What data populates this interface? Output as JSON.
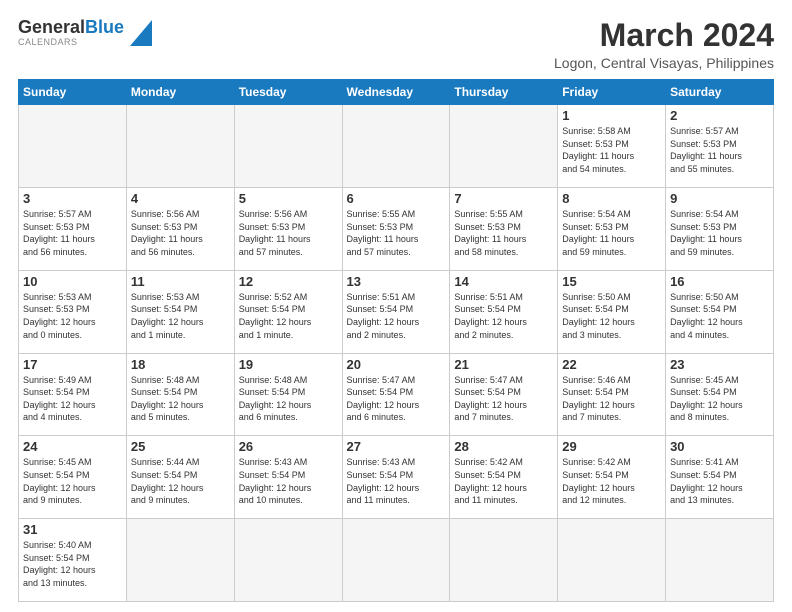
{
  "header": {
    "logo_general": "General",
    "logo_blue": "Blue",
    "title": "March 2024",
    "subtitle": "Logon, Central Visayas, Philippines"
  },
  "days_of_week": [
    "Sunday",
    "Monday",
    "Tuesday",
    "Wednesday",
    "Thursday",
    "Friday",
    "Saturday"
  ],
  "weeks": [
    [
      {
        "day": "",
        "info": ""
      },
      {
        "day": "",
        "info": ""
      },
      {
        "day": "",
        "info": ""
      },
      {
        "day": "",
        "info": ""
      },
      {
        "day": "",
        "info": ""
      },
      {
        "day": "1",
        "info": "Sunrise: 5:58 AM\nSunset: 5:53 PM\nDaylight: 11 hours\nand 54 minutes."
      },
      {
        "day": "2",
        "info": "Sunrise: 5:57 AM\nSunset: 5:53 PM\nDaylight: 11 hours\nand 55 minutes."
      }
    ],
    [
      {
        "day": "3",
        "info": "Sunrise: 5:57 AM\nSunset: 5:53 PM\nDaylight: 11 hours\nand 56 minutes."
      },
      {
        "day": "4",
        "info": "Sunrise: 5:56 AM\nSunset: 5:53 PM\nDaylight: 11 hours\nand 56 minutes."
      },
      {
        "day": "5",
        "info": "Sunrise: 5:56 AM\nSunset: 5:53 PM\nDaylight: 11 hours\nand 57 minutes."
      },
      {
        "day": "6",
        "info": "Sunrise: 5:55 AM\nSunset: 5:53 PM\nDaylight: 11 hours\nand 57 minutes."
      },
      {
        "day": "7",
        "info": "Sunrise: 5:55 AM\nSunset: 5:53 PM\nDaylight: 11 hours\nand 58 minutes."
      },
      {
        "day": "8",
        "info": "Sunrise: 5:54 AM\nSunset: 5:53 PM\nDaylight: 11 hours\nand 59 minutes."
      },
      {
        "day": "9",
        "info": "Sunrise: 5:54 AM\nSunset: 5:53 PM\nDaylight: 11 hours\nand 59 minutes."
      }
    ],
    [
      {
        "day": "10",
        "info": "Sunrise: 5:53 AM\nSunset: 5:53 PM\nDaylight: 12 hours\nand 0 minutes."
      },
      {
        "day": "11",
        "info": "Sunrise: 5:53 AM\nSunset: 5:54 PM\nDaylight: 12 hours\nand 1 minute."
      },
      {
        "day": "12",
        "info": "Sunrise: 5:52 AM\nSunset: 5:54 PM\nDaylight: 12 hours\nand 1 minute."
      },
      {
        "day": "13",
        "info": "Sunrise: 5:51 AM\nSunset: 5:54 PM\nDaylight: 12 hours\nand 2 minutes."
      },
      {
        "day": "14",
        "info": "Sunrise: 5:51 AM\nSunset: 5:54 PM\nDaylight: 12 hours\nand 2 minutes."
      },
      {
        "day": "15",
        "info": "Sunrise: 5:50 AM\nSunset: 5:54 PM\nDaylight: 12 hours\nand 3 minutes."
      },
      {
        "day": "16",
        "info": "Sunrise: 5:50 AM\nSunset: 5:54 PM\nDaylight: 12 hours\nand 4 minutes."
      }
    ],
    [
      {
        "day": "17",
        "info": "Sunrise: 5:49 AM\nSunset: 5:54 PM\nDaylight: 12 hours\nand 4 minutes."
      },
      {
        "day": "18",
        "info": "Sunrise: 5:48 AM\nSunset: 5:54 PM\nDaylight: 12 hours\nand 5 minutes."
      },
      {
        "day": "19",
        "info": "Sunrise: 5:48 AM\nSunset: 5:54 PM\nDaylight: 12 hours\nand 6 minutes."
      },
      {
        "day": "20",
        "info": "Sunrise: 5:47 AM\nSunset: 5:54 PM\nDaylight: 12 hours\nand 6 minutes."
      },
      {
        "day": "21",
        "info": "Sunrise: 5:47 AM\nSunset: 5:54 PM\nDaylight: 12 hours\nand 7 minutes."
      },
      {
        "day": "22",
        "info": "Sunrise: 5:46 AM\nSunset: 5:54 PM\nDaylight: 12 hours\nand 7 minutes."
      },
      {
        "day": "23",
        "info": "Sunrise: 5:45 AM\nSunset: 5:54 PM\nDaylight: 12 hours\nand 8 minutes."
      }
    ],
    [
      {
        "day": "24",
        "info": "Sunrise: 5:45 AM\nSunset: 5:54 PM\nDaylight: 12 hours\nand 9 minutes."
      },
      {
        "day": "25",
        "info": "Sunrise: 5:44 AM\nSunset: 5:54 PM\nDaylight: 12 hours\nand 9 minutes."
      },
      {
        "day": "26",
        "info": "Sunrise: 5:43 AM\nSunset: 5:54 PM\nDaylight: 12 hours\nand 10 minutes."
      },
      {
        "day": "27",
        "info": "Sunrise: 5:43 AM\nSunset: 5:54 PM\nDaylight: 12 hours\nand 11 minutes."
      },
      {
        "day": "28",
        "info": "Sunrise: 5:42 AM\nSunset: 5:54 PM\nDaylight: 12 hours\nand 11 minutes."
      },
      {
        "day": "29",
        "info": "Sunrise: 5:42 AM\nSunset: 5:54 PM\nDaylight: 12 hours\nand 12 minutes."
      },
      {
        "day": "30",
        "info": "Sunrise: 5:41 AM\nSunset: 5:54 PM\nDaylight: 12 hours\nand 13 minutes."
      }
    ],
    [
      {
        "day": "31",
        "info": "Sunrise: 5:40 AM\nSunset: 5:54 PM\nDaylight: 12 hours\nand 13 minutes."
      },
      {
        "day": "",
        "info": ""
      },
      {
        "day": "",
        "info": ""
      },
      {
        "day": "",
        "info": ""
      },
      {
        "day": "",
        "info": ""
      },
      {
        "day": "",
        "info": ""
      },
      {
        "day": "",
        "info": ""
      }
    ]
  ]
}
